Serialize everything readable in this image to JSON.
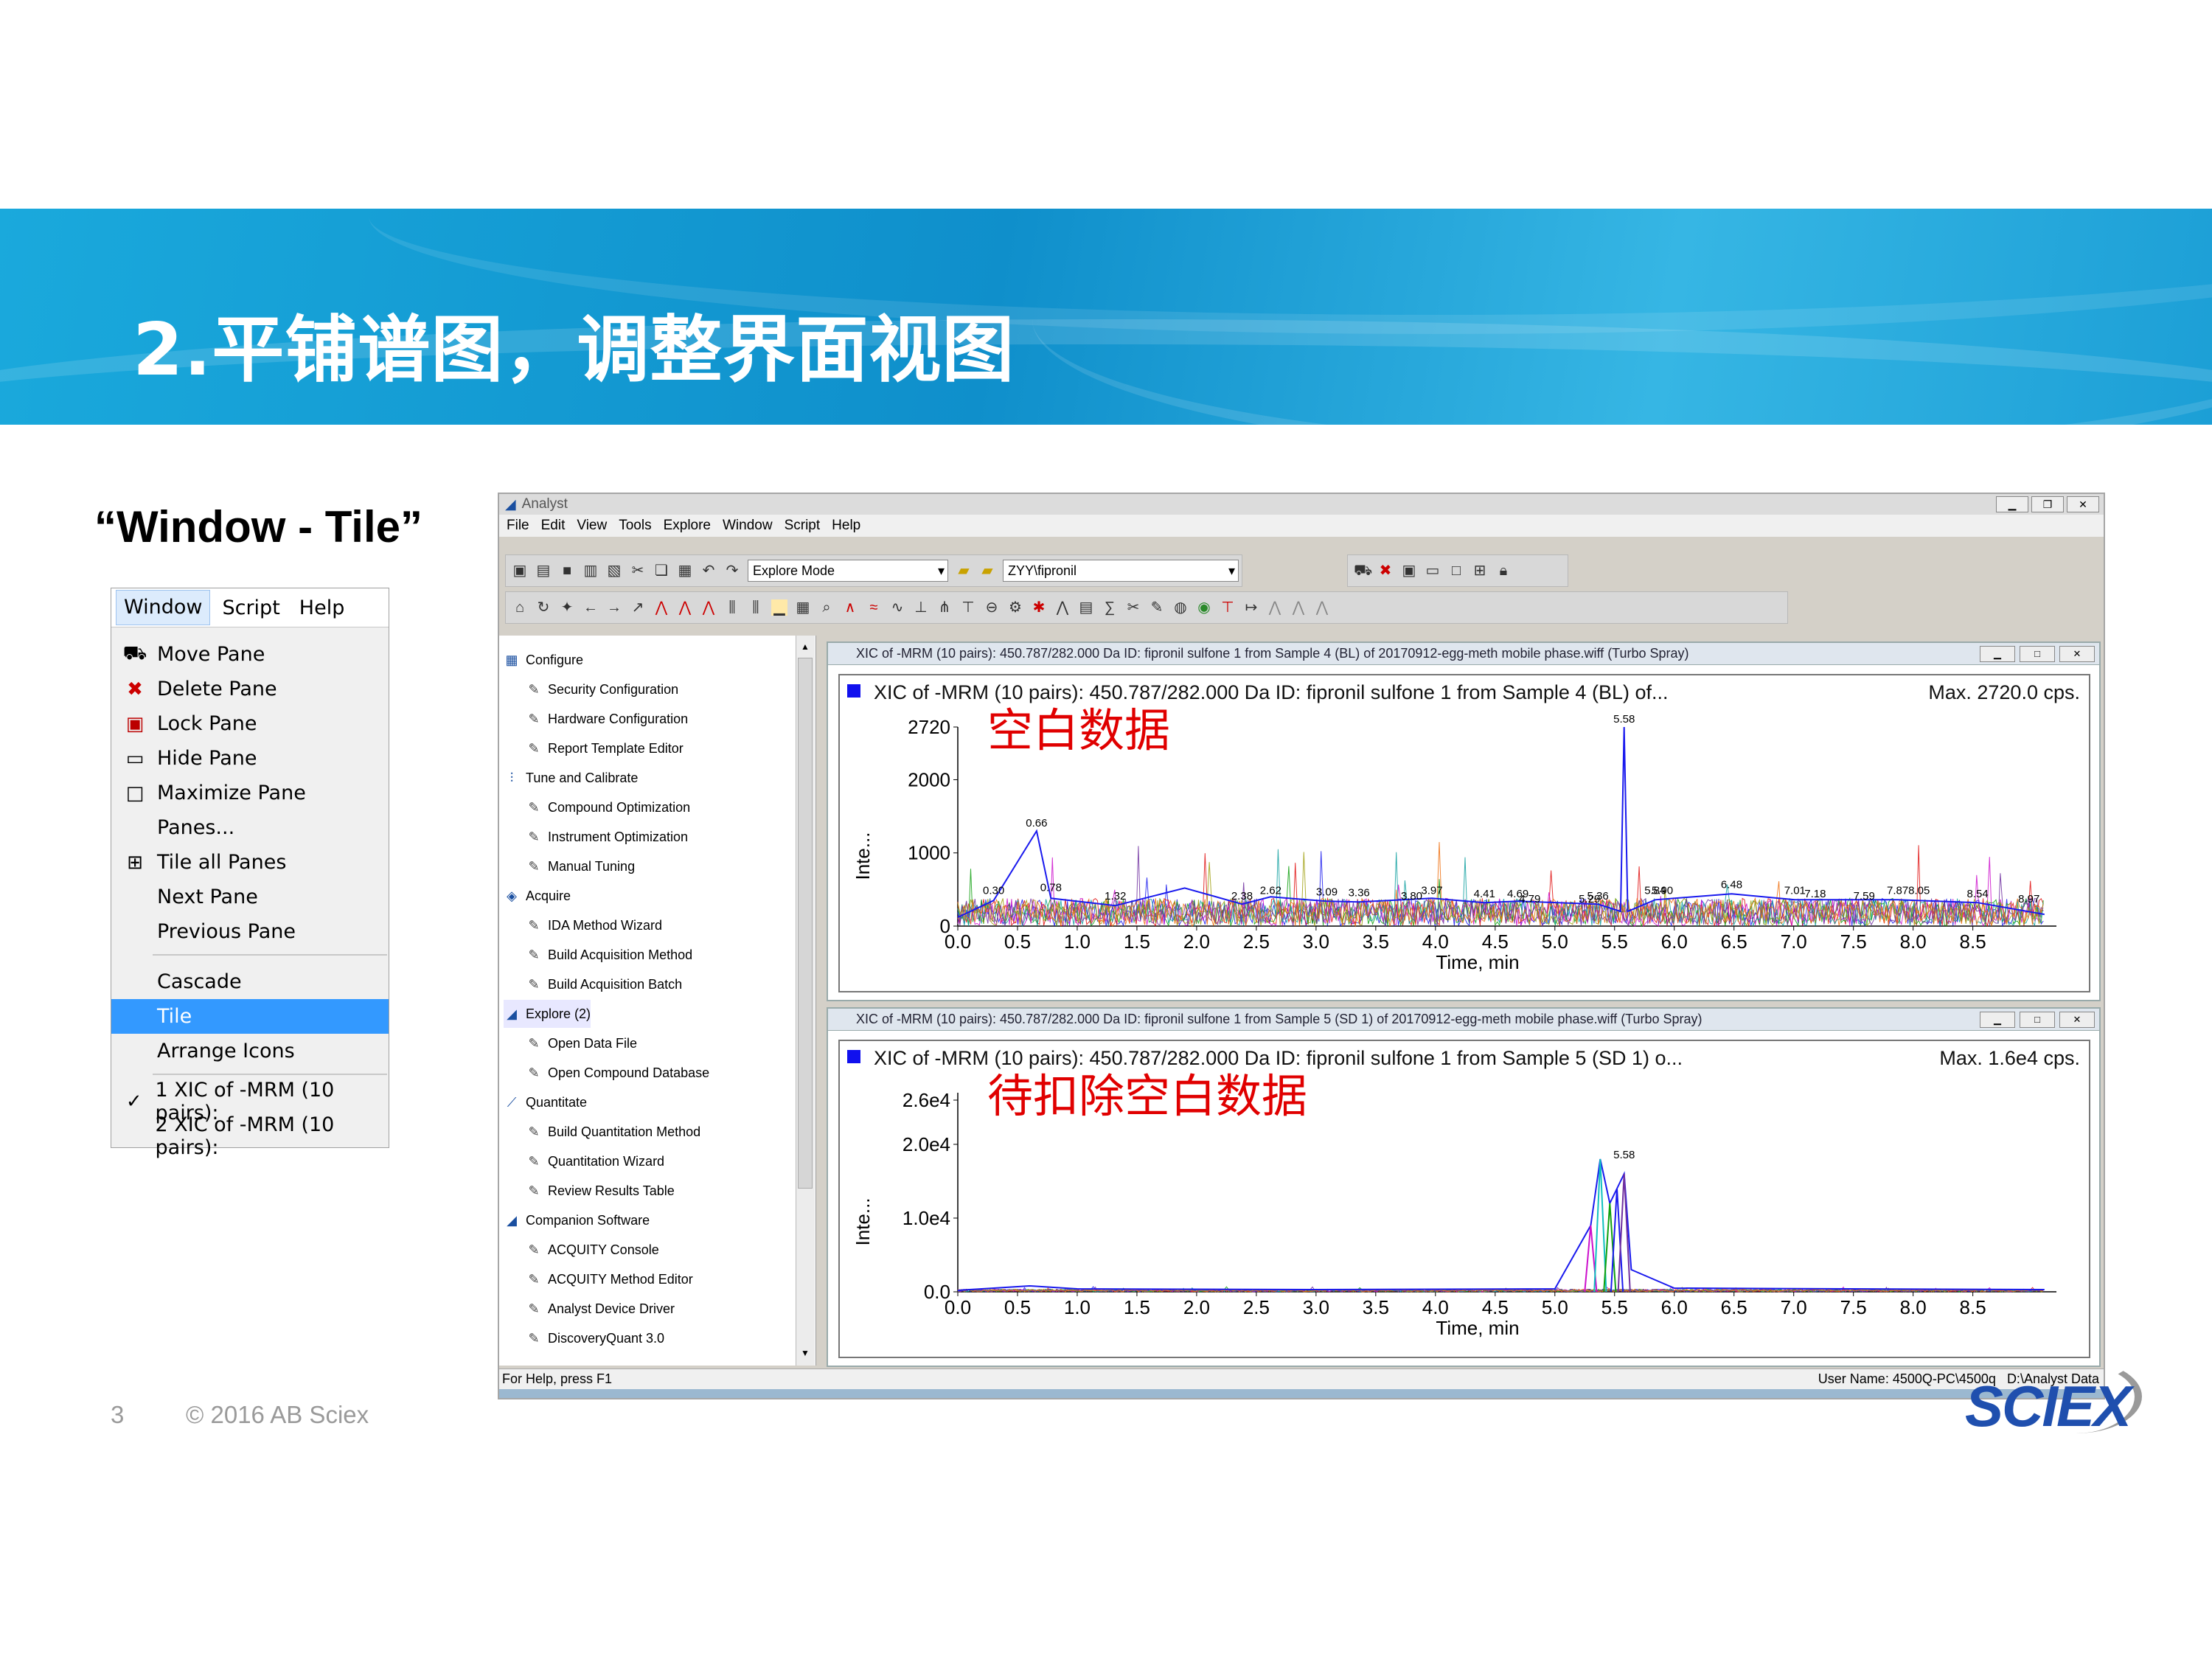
{
  "slide": {
    "title": "2.平铺谱图，调整界面视图",
    "subtitle": "“Window - Tile”",
    "page_number": "3",
    "copyright": "© 2016 AB Sciex",
    "logo": "SCIEX"
  },
  "window_menu": {
    "menubar": [
      "Window",
      "Script",
      "Help"
    ],
    "items": [
      {
        "label": "Move Pane",
        "icon": "truck-icon"
      },
      {
        "label": "Delete Pane",
        "icon": "delete-x-icon"
      },
      {
        "label": "Lock Pane",
        "icon": "lock-icon"
      },
      {
        "label": "Hide Pane",
        "icon": "hide-pane-icon"
      },
      {
        "label": "Maximize Pane",
        "icon": "maximize-icon"
      },
      {
        "label": "Panes...",
        "icon": ""
      },
      {
        "label": "Tile all Panes",
        "icon": "grid-icon"
      },
      {
        "label": "Next Pane",
        "icon": ""
      },
      {
        "label": "Previous Pane",
        "icon": ""
      },
      {
        "label": "Cascade",
        "icon": ""
      },
      {
        "label": "Tile",
        "icon": "",
        "selected": true
      },
      {
        "label": "Arrange Icons",
        "icon": ""
      },
      {
        "label": "1 XIC of -MRM (10 pairs):",
        "icon": "check-icon"
      },
      {
        "label": "2 XIC of -MRM (10 pairs):",
        "icon": ""
      }
    ]
  },
  "app": {
    "title": "Analyst",
    "menus": [
      "File",
      "Edit",
      "View",
      "Tools",
      "Explore",
      "Window",
      "Script",
      "Help"
    ],
    "mode": "Explore Mode",
    "project": "ZYY\\fipronil",
    "status_left": "For Help, press F1",
    "status_user": "User Name: 4500Q-PC\\4500q",
    "status_data": "D:\\Analyst Data"
  },
  "nav_tree": [
    {
      "label": "Configure",
      "group": true
    },
    {
      "label": "Security Configuration"
    },
    {
      "label": "Hardware Configuration"
    },
    {
      "label": "Report Template Editor"
    },
    {
      "label": "Tune and Calibrate",
      "group": true
    },
    {
      "label": "Compound Optimization"
    },
    {
      "label": "Instrument Optimization"
    },
    {
      "label": "Manual Tuning"
    },
    {
      "label": "Acquire",
      "group": true
    },
    {
      "label": "IDA Method Wizard"
    },
    {
      "label": "Build Acquisition Method"
    },
    {
      "label": "Build Acquisition Batch"
    },
    {
      "label": "Explore  (2)",
      "group": true,
      "active": true
    },
    {
      "label": "Open Data File"
    },
    {
      "label": "Open Compound Database"
    },
    {
      "label": "Quantitate",
      "group": true
    },
    {
      "label": "Build Quantitation Method"
    },
    {
      "label": "Quantitation Wizard"
    },
    {
      "label": "Review Results Table"
    },
    {
      "label": "Companion Software",
      "group": true
    },
    {
      "label": "ACQUITY Console"
    },
    {
      "label": "ACQUITY Method Editor"
    },
    {
      "label": "Analyst Device Driver"
    },
    {
      "label": "DiscoveryQuant 3.0"
    }
  ],
  "panes": [
    {
      "title": "XIC of -MRM (10 pairs): 450.787/282.000 Da ID: fipronil sulfone 1 from Sample 4 (BL) of 20170912-egg-meth mobile phase.wiff (Turbo Spray)",
      "header": "XIC of -MRM (10 pairs): 450.787/282.000 Da ID: fipronil sulfone 1 from Sample 4 (BL) of...",
      "max": "Max. 2720.0 cps.",
      "annotation": "空白数据"
    },
    {
      "title": "XIC of -MRM (10 pairs): 450.787/282.000 Da ID: fipronil sulfone 1 from Sample 5 (SD 1) of 20170912-egg-meth mobile phase.wiff (Turbo Spray)",
      "header": "XIC of -MRM (10 pairs): 450.787/282.000 Da ID: fipronil sulfone 1 from Sample 5 (SD 1) o...",
      "max": "Max. 1.6e4 cps.",
      "annotation": "待扣除空白数据"
    }
  ],
  "chart_data": [
    {
      "type": "line",
      "xlabel": "Time, min",
      "ylabel": "Inte...",
      "xlim": [
        0,
        9.2
      ],
      "ylim": [
        0,
        2720
      ],
      "xticks": [
        "0.0",
        "0.5",
        "1.0",
        "1.5",
        "2.0",
        "2.5",
        "3.0",
        "3.5",
        "4.0",
        "4.5",
        "5.0",
        "5.5",
        "6.0",
        "6.5",
        "7.0",
        "7.5",
        "8.0",
        "8.5"
      ],
      "yticks": [
        {
          "v": 0,
          "t": "0"
        },
        {
          "v": 1000,
          "t": "1000"
        },
        {
          "v": 2000,
          "t": "2000"
        },
        {
          "v": 2720,
          "t": "2720"
        }
      ],
      "peak_labels": [
        [
          "0.30",
          0.3,
          380
        ],
        [
          "0.66",
          0.66,
          1300
        ],
        [
          "0.78",
          0.78,
          420
        ],
        [
          "1.32",
          1.32,
          300
        ],
        [
          "2.38",
          2.38,
          300
        ],
        [
          "2.62",
          2.62,
          380
        ],
        [
          "3.09",
          3.09,
          360
        ],
        [
          "3.36",
          3.36,
          350
        ],
        [
          "3.80",
          3.8,
          300
        ],
        [
          "3.97",
          3.97,
          380
        ],
        [
          "4.41",
          4.41,
          330
        ],
        [
          "4.69",
          4.69,
          330
        ],
        [
          "4.79",
          4.79,
          260
        ],
        [
          "5.29",
          5.29,
          260
        ],
        [
          "5.36",
          5.36,
          300
        ],
        [
          "5.58",
          5.58,
          2720
        ],
        [
          "5.84",
          5.84,
          380
        ],
        [
          "5.90",
          5.9,
          380
        ],
        [
          "6.48",
          6.48,
          460
        ],
        [
          "7.01",
          7.01,
          380
        ],
        [
          "7.18",
          7.18,
          330
        ],
        [
          "7.59",
          7.59,
          300
        ],
        [
          "7.87",
          7.87,
          380
        ],
        [
          "8.05",
          8.05,
          380
        ],
        [
          "8.54",
          8.54,
          330
        ],
        [
          "8.97",
          8.97,
          260
        ]
      ],
      "series": [
        {
          "values": [
            [
              0.0,
              120
            ],
            [
              0.3,
              350
            ],
            [
              0.66,
              1300
            ],
            [
              0.78,
              380
            ],
            [
              1.32,
              280
            ],
            [
              1.9,
              520
            ],
            [
              2.38,
              300
            ],
            [
              2.62,
              400
            ],
            [
              3.09,
              340
            ],
            [
              3.36,
              330
            ],
            [
              3.97,
              380
            ],
            [
              4.41,
              320
            ],
            [
              4.69,
              340
            ],
            [
              5.36,
              300
            ],
            [
              5.55,
              200
            ],
            [
              5.58,
              2720
            ],
            [
              5.61,
              200
            ],
            [
              5.84,
              360
            ],
            [
              6.48,
              440
            ],
            [
              7.01,
              360
            ],
            [
              7.87,
              360
            ],
            [
              8.54,
              320
            ],
            [
              9.1,
              160
            ]
          ]
        }
      ]
    },
    {
      "type": "line",
      "xlabel": "Time, min",
      "ylabel": "Inte...",
      "xlim": [
        0,
        9.2
      ],
      "ylim": [
        0,
        27000
      ],
      "xticks": [
        "0.0",
        "0.5",
        "1.0",
        "1.5",
        "2.0",
        "2.5",
        "3.0",
        "3.5",
        "4.0",
        "4.5",
        "5.0",
        "5.5",
        "6.0",
        "6.5",
        "7.0",
        "7.5",
        "8.0",
        "8.5"
      ],
      "yticks": [
        {
          "v": 0,
          "t": "0.0"
        },
        {
          "v": 10000,
          "t": "1.0e4"
        },
        {
          "v": 20000,
          "t": "2.0e4"
        },
        {
          "v": 26000,
          "t": "2.6e4"
        }
      ],
      "peak_labels": [
        [
          "5.58",
          5.58,
          17500
        ]
      ],
      "series": [
        {
          "values": [
            [
              0.0,
              200
            ],
            [
              0.6,
              800
            ],
            [
              1.0,
              400
            ],
            [
              3.0,
              300
            ],
            [
              5.0,
              400
            ],
            [
              5.3,
              9000
            ],
            [
              5.38,
              18000
            ],
            [
              5.46,
              12000
            ],
            [
              5.52,
              14000
            ],
            [
              5.58,
              16000
            ],
            [
              5.64,
              3000
            ],
            [
              6.0,
              500
            ],
            [
              9.1,
              300
            ]
          ]
        }
      ]
    }
  ]
}
